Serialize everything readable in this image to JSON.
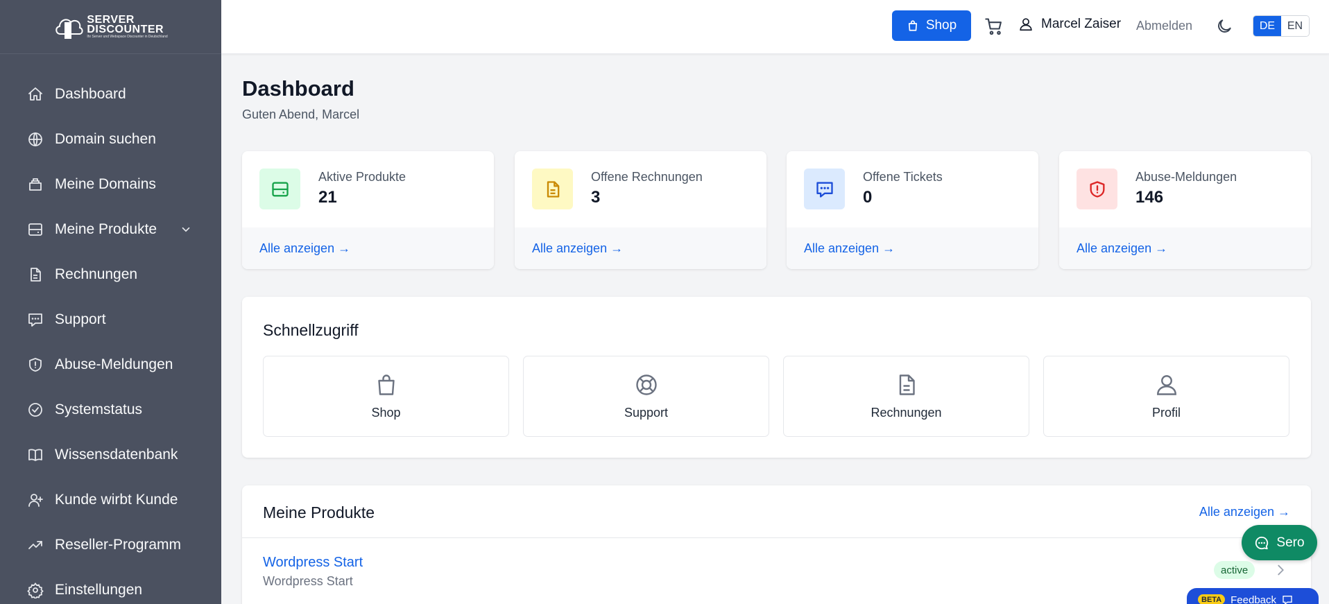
{
  "brand": {
    "name": "SERVER DISCOUNTER",
    "tagline": "Ihr Server und Webspace Discounter in Deutschland"
  },
  "sidebar": {
    "items": [
      {
        "label": "Dashboard",
        "icon": "home-icon"
      },
      {
        "label": "Domain suchen",
        "icon": "globe-icon"
      },
      {
        "label": "Meine Domains",
        "icon": "bag-icon"
      },
      {
        "label": "Meine Produkte",
        "icon": "server-icon",
        "expandable": true
      },
      {
        "label": "Rechnungen",
        "icon": "document-icon"
      },
      {
        "label": "Support",
        "icon": "chat-icon"
      },
      {
        "label": "Abuse-Meldungen",
        "icon": "shield-icon"
      },
      {
        "label": "Systemstatus",
        "icon": "check-circle-icon"
      },
      {
        "label": "Wissensdatenbank",
        "icon": "book-icon"
      },
      {
        "label": "Kunde wirbt Kunde",
        "icon": "user-plus-icon"
      },
      {
        "label": "Reseller-Programm",
        "icon": "trending-up-icon"
      },
      {
        "label": "Einstellungen",
        "icon": "gear-icon"
      }
    ]
  },
  "header": {
    "shop_label": "Shop",
    "user_name": "Marcel Zaiser",
    "logout_label": "Abmelden",
    "lang_de": "DE",
    "lang_en": "EN",
    "active_lang": "DE"
  },
  "main": {
    "title": "Dashboard",
    "greeting": "Guten Abend, Marcel",
    "stats": [
      {
        "label": "Aktive Produkte",
        "value": "21",
        "link": "Alle anzeigen →",
        "color": "#16a34a",
        "bg": "#dcfce7"
      },
      {
        "label": "Offene Rechnungen",
        "value": "3",
        "link": "Alle anzeigen →",
        "color": "#ca8a04",
        "bg": "#fef9c3"
      },
      {
        "label": "Offene Tickets",
        "value": "0",
        "link": "Alle anzeigen →",
        "color": "#1d4ed8",
        "bg": "#dbeafe"
      },
      {
        "label": "Abuse-Meldungen",
        "value": "146",
        "link": "Alle anzeigen →",
        "color": "#dc2626",
        "bg": "#fee2e2"
      }
    ],
    "quick_access": {
      "title": "Schnellzugriff",
      "tiles": [
        {
          "label": "Shop",
          "icon": "shopping-bag-icon"
        },
        {
          "label": "Support",
          "icon": "lifebuoy-icon"
        },
        {
          "label": "Rechnungen",
          "icon": "document-icon"
        },
        {
          "label": "Profil",
          "icon": "user-icon"
        }
      ]
    },
    "products": {
      "title": "Meine Produkte",
      "all_link": "Alle anzeigen →",
      "items": [
        {
          "name": "Wordpress Start",
          "subtitle": "Wordpress Start",
          "status": "active"
        }
      ]
    }
  },
  "widgets": {
    "chat_label": "Sero",
    "feedback_label": "Feedback",
    "beta_label": "BETA"
  }
}
